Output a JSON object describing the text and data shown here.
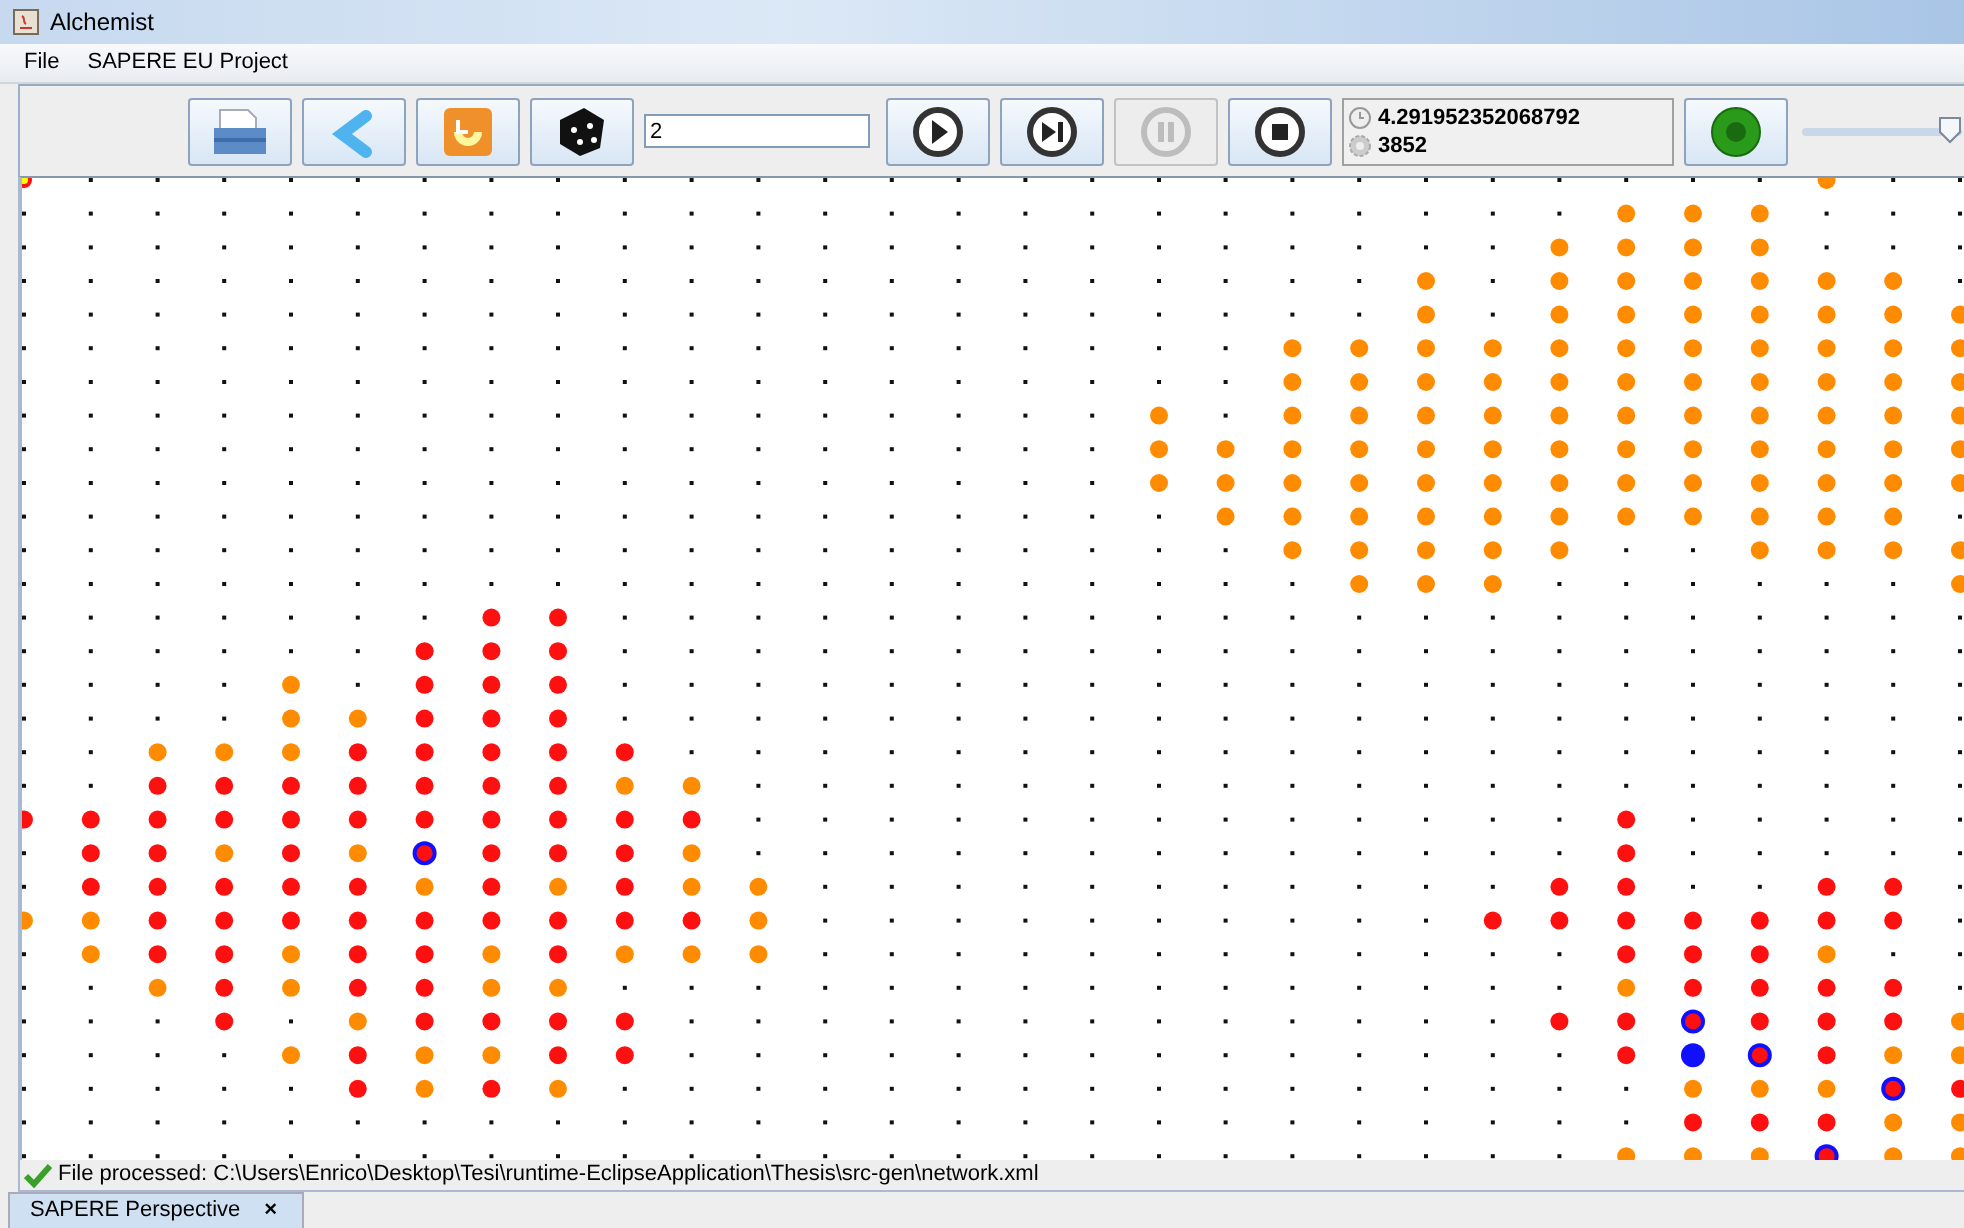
{
  "window": {
    "title": "Alchemist"
  },
  "menu": [
    "File",
    "SAPERE EU Project"
  ],
  "toolbar": {
    "buttons": [
      {
        "kind": "save",
        "disabled": false
      },
      {
        "kind": "back",
        "disabled": false
      },
      {
        "kind": "reload",
        "disabled": false
      },
      {
        "kind": "dice",
        "disabled": false
      }
    ],
    "steps_field": {
      "value": "2"
    },
    "controls": [
      {
        "kind": "play",
        "disabled": false
      },
      {
        "kind": "step",
        "disabled": false
      },
      {
        "kind": "pause",
        "disabled": true
      },
      {
        "kind": "stop",
        "disabled": false
      }
    ],
    "time": "4.291952352068792",
    "step_count": "3852",
    "run_button": {
      "kind": "go",
      "disabled": false
    },
    "speed_slider": {
      "level": 0.93
    }
  },
  "status_bar": {
    "message": "File processed: C:\\Users\\Enrico\\Desktop\\Tesi\\runtime-EclipseApplication\\Thesis\\src-gen\\network.xml"
  },
  "tabs": [
    {
      "label": "SAPERE Perspective",
      "close": "×",
      "selected": true
    }
  ]
}
